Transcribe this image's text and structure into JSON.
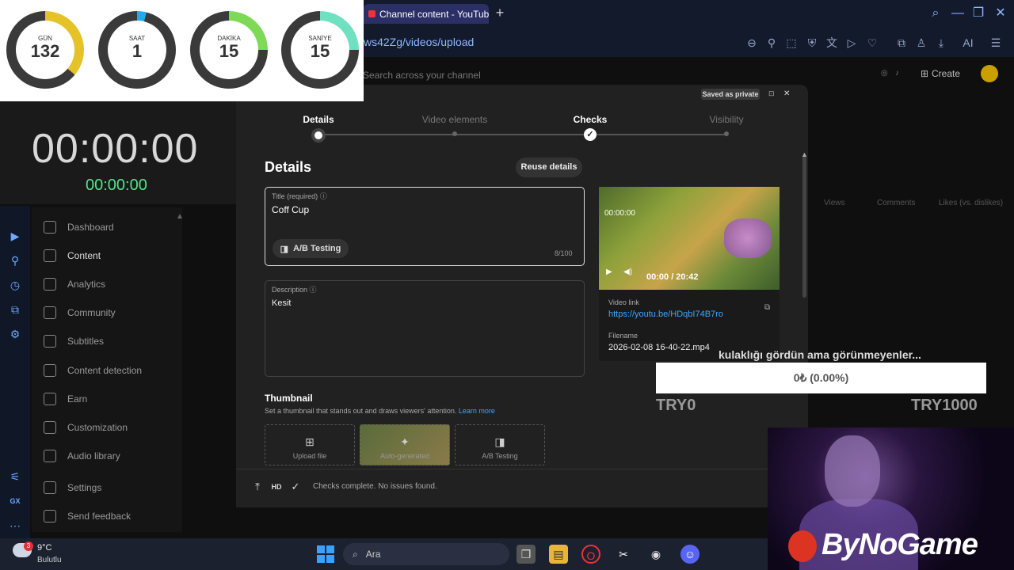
{
  "browser": {
    "tab_title": "Channel content - YouTube",
    "url": "ws42Zg/videos/upload",
    "new_tab": "+",
    "toolbar_ai": "AI"
  },
  "studio": {
    "search_placeholder": "Search across your channel",
    "create": "Create",
    "nav": [
      {
        "label": "Dashboard"
      },
      {
        "label": "Content"
      },
      {
        "label": "Analytics"
      },
      {
        "label": "Community"
      },
      {
        "label": "Subtitles"
      },
      {
        "label": "Content detection"
      },
      {
        "label": "Earn"
      },
      {
        "label": "Customization"
      },
      {
        "label": "Audio library"
      },
      {
        "label": "Settings"
      },
      {
        "label": "Send feedback"
      }
    ],
    "columns": [
      "Views",
      "Comments",
      "Likes (vs. dislikes)"
    ]
  },
  "dialog": {
    "saved_badge": "Saved as private",
    "steps": [
      "Details",
      "Video elements",
      "Checks",
      "Visibility"
    ],
    "heading": "Details",
    "reuse": "Reuse details",
    "title_label": "Title (required)",
    "title_value": "Coff Cup",
    "ab_testing": "A/B Testing",
    "title_count": "8/100",
    "desc_label": "Description",
    "desc_value": "Kesit",
    "thumb_heading": "Thumbnail",
    "thumb_sub": "Set a thumbnail that stands out and draws viewers' attention.",
    "thumb_learn": "Learn more",
    "thumb_opts": [
      "Upload file",
      "Auto-generated",
      "A/B Testing"
    ],
    "video_overlay_time": "00:00:00",
    "video_time": "00:00 / 20:42",
    "video_link_label": "Video link",
    "video_link": "https://youtu.be/HDqbI74B7ro",
    "filename_label": "Filename",
    "filename": "2026-02-08 16-40-22.mp4",
    "footer_status": "Checks complete. No issues found."
  },
  "countdown": [
    {
      "label": "GÜN",
      "value": "132",
      "fraction": 0.36,
      "color": "#e6c229"
    },
    {
      "label": "SAAT",
      "value": "1",
      "fraction": 0.04,
      "color": "#29a8e6"
    },
    {
      "label": "DAKİKA",
      "value": "15",
      "fraction": 0.25,
      "color": "#7ed957"
    },
    {
      "label": "SANİYE",
      "value": "15",
      "fraction": 0.25,
      "color": "#6fe0c0"
    }
  ],
  "timer": {
    "big": "00:00:00",
    "small": "00:00:00"
  },
  "donation": {
    "title": "kulaklığı gördün ama görünmeyenler...",
    "progress": "0₺ (0.00%)",
    "min": "TRY0",
    "max": "TRY1000"
  },
  "logo": "ByNoGame",
  "taskbar": {
    "temp": "9°C",
    "condition": "Bulutlu",
    "badge": "3",
    "search": "Ara"
  }
}
